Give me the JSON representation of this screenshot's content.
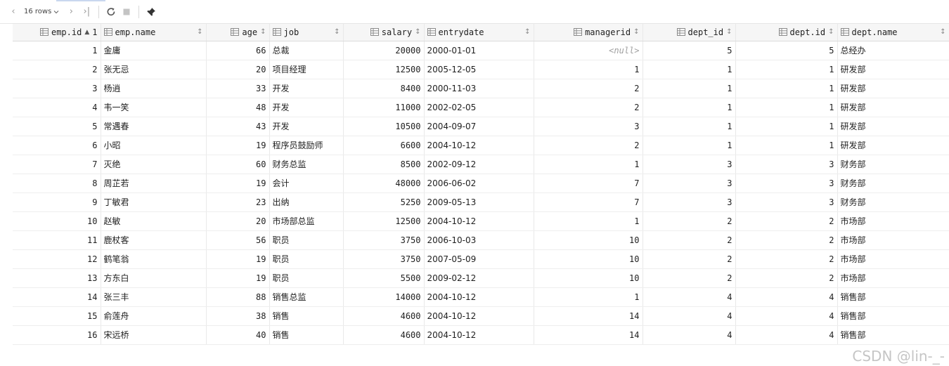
{
  "toolbar": {
    "rows_label": "16 rows",
    "icons": [
      "chevron-left-icon",
      "chevron-right-icon",
      "last-page-icon",
      "refresh-icon",
      "stop-icon",
      "pin-icon"
    ]
  },
  "columns": [
    {
      "key": "emp_id",
      "label": "emp.id",
      "sort_order": "1",
      "align": "num"
    },
    {
      "key": "emp_name",
      "label": "emp.name",
      "align": "txt"
    },
    {
      "key": "age",
      "label": "age",
      "align": "num"
    },
    {
      "key": "job",
      "label": "job",
      "align": "txt"
    },
    {
      "key": "salary",
      "label": "salary",
      "align": "num"
    },
    {
      "key": "entrydate",
      "label": "entrydate",
      "align": "txt"
    },
    {
      "key": "managerid",
      "label": "managerid",
      "align": "num"
    },
    {
      "key": "dept_id",
      "label": "dept_id",
      "align": "num"
    },
    {
      "key": "dept_id2",
      "label": "dept.id",
      "align": "num"
    },
    {
      "key": "dept_name",
      "label": "dept.name",
      "align": "txt"
    }
  ],
  "null_text": "<null>",
  "rows": [
    [
      "1",
      "金庸",
      "66",
      "总裁",
      "20000",
      "2000-01-01",
      null,
      "5",
      "5",
      "总经办"
    ],
    [
      "2",
      "张无忌",
      "20",
      "项目经理",
      "12500",
      "2005-12-05",
      "1",
      "1",
      "1",
      "研发部"
    ],
    [
      "3",
      "杨逍",
      "33",
      "开发",
      "8400",
      "2000-11-03",
      "2",
      "1",
      "1",
      "研发部"
    ],
    [
      "4",
      "韦一笑",
      "48",
      "开发",
      "11000",
      "2002-02-05",
      "2",
      "1",
      "1",
      "研发部"
    ],
    [
      "5",
      "常遇春",
      "43",
      "开发",
      "10500",
      "2004-09-07",
      "3",
      "1",
      "1",
      "研发部"
    ],
    [
      "6",
      "小昭",
      "19",
      "程序员鼓励师",
      "6600",
      "2004-10-12",
      "2",
      "1",
      "1",
      "研发部"
    ],
    [
      "7",
      "灭绝",
      "60",
      "财务总监",
      "8500",
      "2002-09-12",
      "1",
      "3",
      "3",
      "财务部"
    ],
    [
      "8",
      "周芷若",
      "19",
      "会计",
      "48000",
      "2006-06-02",
      "7",
      "3",
      "3",
      "财务部"
    ],
    [
      "9",
      "丁敏君",
      "23",
      "出纳",
      "5250",
      "2009-05-13",
      "7",
      "3",
      "3",
      "财务部"
    ],
    [
      "10",
      "赵敏",
      "20",
      "市场部总监",
      "12500",
      "2004-10-12",
      "1",
      "2",
      "2",
      "市场部"
    ],
    [
      "11",
      "鹿杖客",
      "56",
      "职员",
      "3750",
      "2006-10-03",
      "10",
      "2",
      "2",
      "市场部"
    ],
    [
      "12",
      "鹤笔翁",
      "19",
      "职员",
      "3750",
      "2007-05-09",
      "10",
      "2",
      "2",
      "市场部"
    ],
    [
      "13",
      "方东白",
      "19",
      "职员",
      "5500",
      "2009-02-12",
      "10",
      "2",
      "2",
      "市场部"
    ],
    [
      "14",
      "张三丰",
      "88",
      "销售总监",
      "14000",
      "2004-10-12",
      "1",
      "4",
      "4",
      "销售部"
    ],
    [
      "15",
      "俞莲舟",
      "38",
      "销售",
      "4600",
      "2004-10-12",
      "14",
      "4",
      "4",
      "销售部"
    ],
    [
      "16",
      "宋远桥",
      "40",
      "销售",
      "4600",
      "2004-10-12",
      "14",
      "4",
      "4",
      "销售部"
    ]
  ],
  "watermark": "CSDN @lin-_-"
}
